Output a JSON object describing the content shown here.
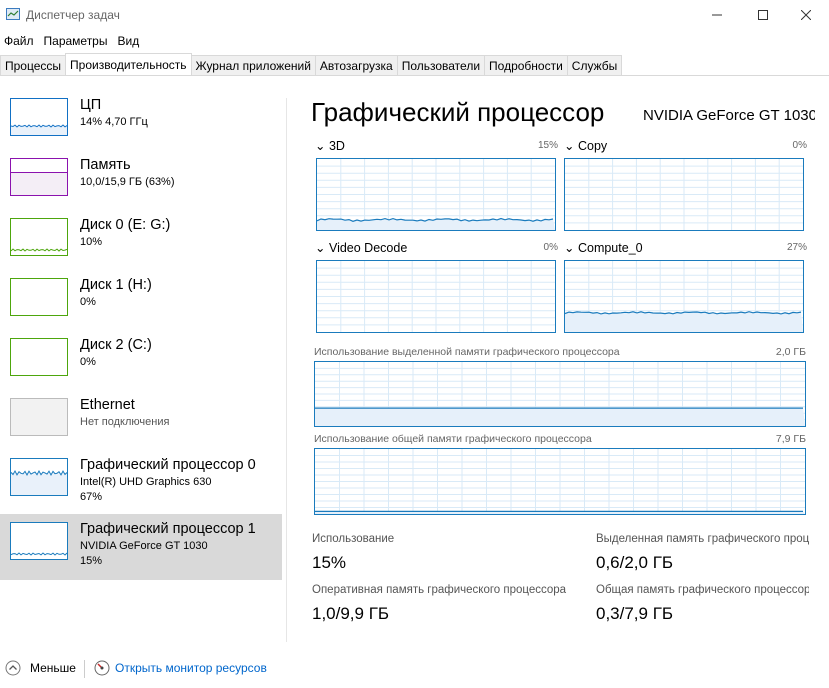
{
  "window": {
    "title": "Диспетчер задач"
  },
  "menu": [
    "Файл",
    "Параметры",
    "Вид"
  ],
  "tabs": [
    "Процессы",
    "Производительность",
    "Журнал приложений",
    "Автозагрузка",
    "Пользователи",
    "Подробности",
    "Службы"
  ],
  "active_tab": 1,
  "sidebar": [
    {
      "name": "ЦП",
      "sub1": "14% 4,70 ГГц",
      "sub2": "",
      "color": "#1170c4"
    },
    {
      "name": "Память",
      "sub1": "10,0/15,9 ГБ (63%)",
      "sub2": "",
      "color": "#8b12ae"
    },
    {
      "name": "Диск 0 (E: G:)",
      "sub1": "10%",
      "sub2": "",
      "color": "#4da60c"
    },
    {
      "name": "Диск 1 (H:)",
      "sub1": "0%",
      "sub2": "",
      "color": "#4da60c"
    },
    {
      "name": "Диск 2 (C:)",
      "sub1": "0%",
      "sub2": "",
      "color": "#4da60c"
    },
    {
      "name": "Ethernet",
      "sub1": "Нет подключения",
      "sub2": "",
      "color": "#bbbbbb"
    },
    {
      "name": "Графический процессор 0",
      "sub1": "Intel(R) UHD Graphics 630",
      "sub2": "67%",
      "color": "#1a7bbd"
    },
    {
      "name": "Графический процессор 1",
      "sub1": "NVIDIA GeForce GT 1030",
      "sub2": "15%",
      "color": "#1a7bbd"
    }
  ],
  "main": {
    "title": "Графический процессор",
    "gpu_name": "NVIDIA GeForce GT 1030",
    "engines": [
      {
        "name": "3D",
        "pct": "15%"
      },
      {
        "name": "Copy",
        "pct": "0%"
      },
      {
        "name": "Video Decode",
        "pct": "0%"
      },
      {
        "name": "Compute_0",
        "pct": "27%"
      }
    ],
    "dedicated_mem": {
      "label": "Использование выделенной памяти графического процессора",
      "max": "2,0 ГБ"
    },
    "shared_mem": {
      "label": "Использование общей памяти графического процессора",
      "max": "7,9 ГБ"
    },
    "stats": {
      "usage_label": "Использование",
      "usage_value": "15%",
      "dedicated_label": "Выделенная память графического процессора",
      "dedicated_value": "0,6/2,0 ГБ",
      "gpu_ram_label": "Оперативная память графического процессора",
      "gpu_ram_value": "1,0/9,9 ГБ",
      "shared_label": "Общая память графического процессора",
      "shared_value": "0,3/7,9 ГБ"
    }
  },
  "footer": {
    "less": "Меньше",
    "monitor": "Открыть монитор ресурсов"
  }
}
